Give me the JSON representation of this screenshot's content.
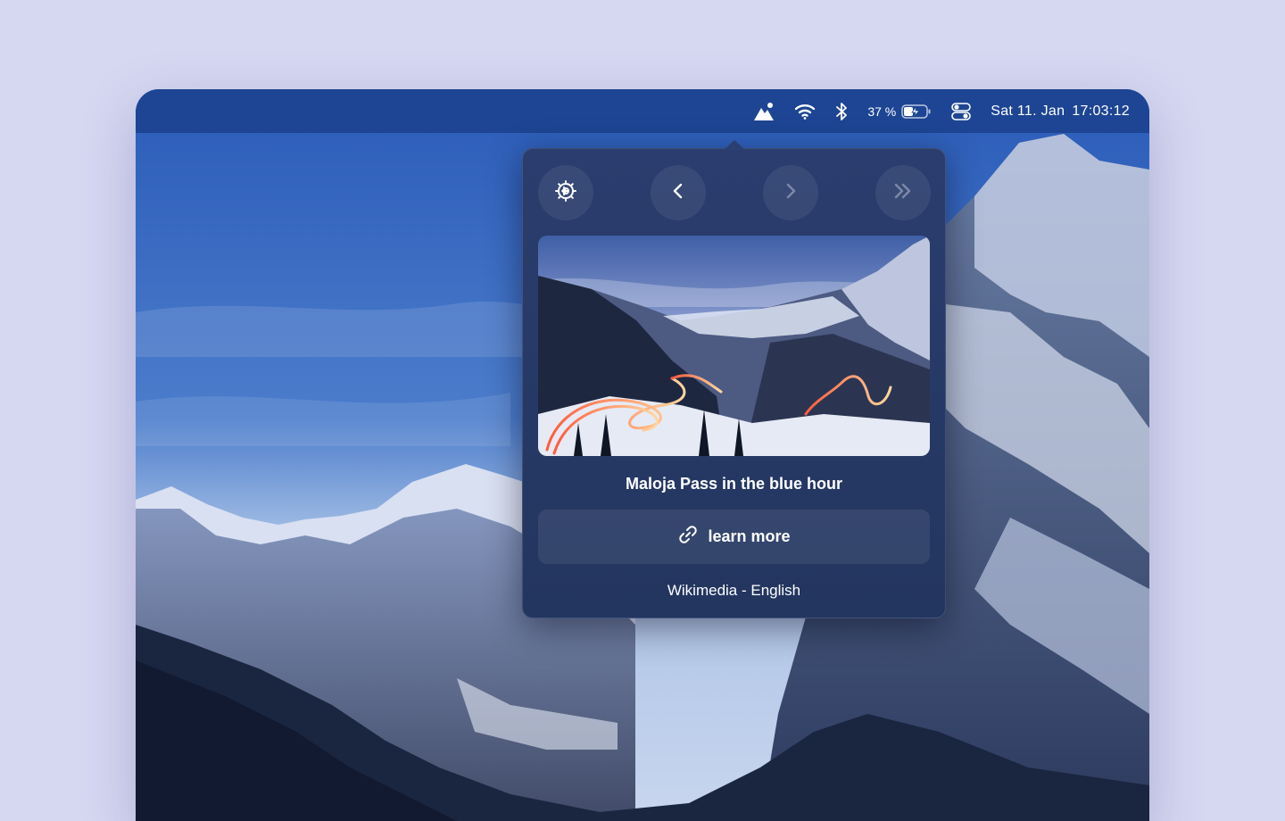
{
  "menubar": {
    "icons": [
      "mountain-icon",
      "wifi-icon",
      "bluetooth-icon",
      "battery-icon",
      "control-center-icon"
    ],
    "battery_percent": "37 %",
    "date": "Sat 11. Jan",
    "time": "17:03:12"
  },
  "popover": {
    "toolbar": {
      "settings_icon": "gear-icon",
      "previous_icon": "chevron-left-icon",
      "next_icon": "chevron-right-icon",
      "latest_icon": "double-chevron-right-icon"
    },
    "title": "Maloja Pass in the blue hour",
    "learn_more_label": "learn more",
    "learn_more_icon": "link-icon",
    "source": "Wikimedia - English"
  },
  "colors": {
    "menubar": "#1d4593",
    "popover": "#283b6a",
    "background": "#d6d7f1"
  }
}
